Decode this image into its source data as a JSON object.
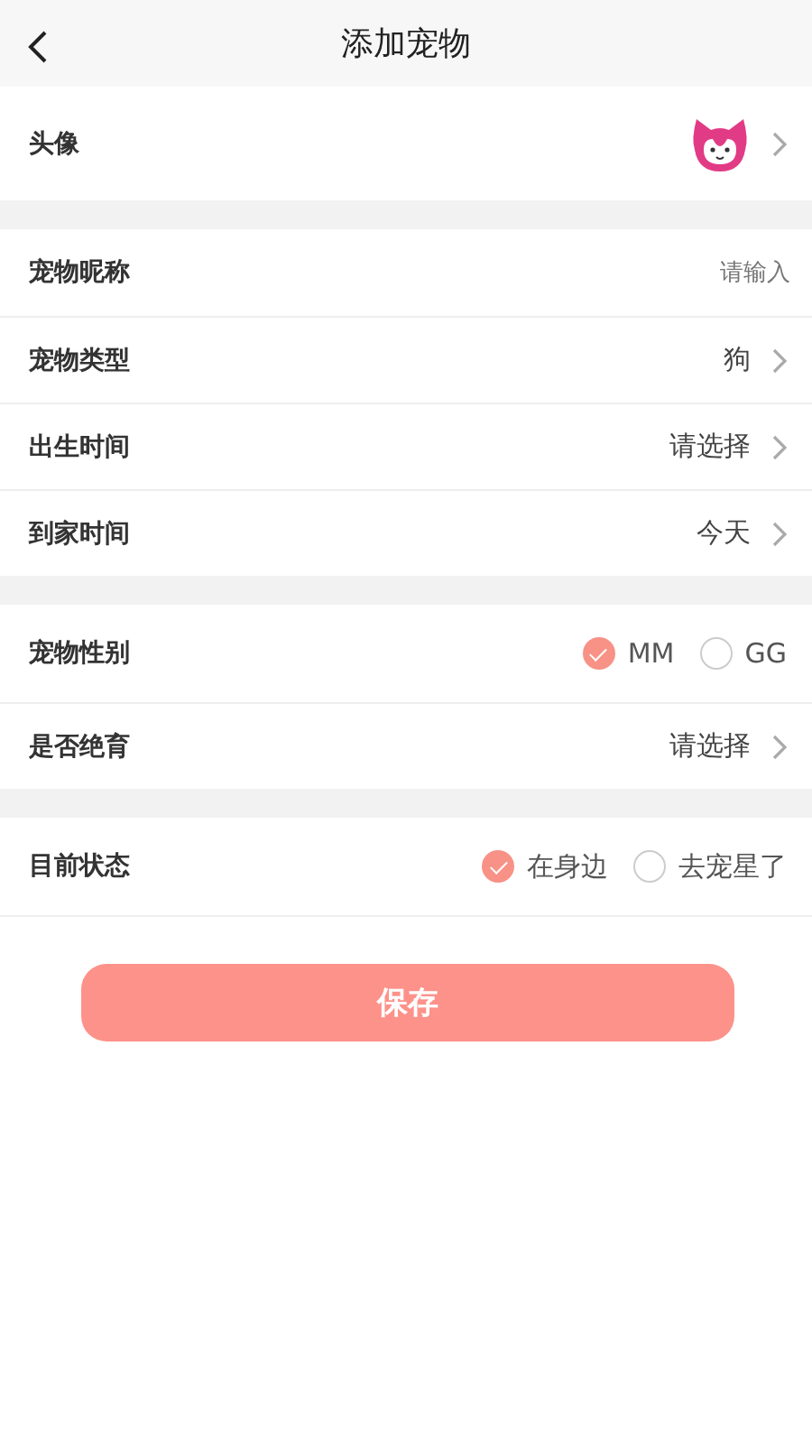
{
  "header": {
    "title": "添加宠物"
  },
  "sections": [
    {
      "rows": [
        {
          "kind": "avatar",
          "label": "头像"
        }
      ]
    },
    {
      "rows": [
        {
          "kind": "input",
          "label": "宠物昵称",
          "placeholder": "请输入"
        },
        {
          "kind": "select",
          "label": "宠物类型",
          "value": "狗"
        },
        {
          "kind": "select",
          "label": "出生时间",
          "value": "请选择"
        },
        {
          "kind": "select",
          "label": "到家时间",
          "value": "今天"
        }
      ]
    },
    {
      "rows": [
        {
          "kind": "radio",
          "label": "宠物性别",
          "options": [
            {
              "label": "MM",
              "selected": true
            },
            {
              "label": "GG",
              "selected": false
            }
          ]
        },
        {
          "kind": "select",
          "label": "是否绝育",
          "value": "请选择"
        }
      ]
    },
    {
      "rows": [
        {
          "kind": "radio",
          "label": "目前状态",
          "options": [
            {
              "label": "在身边",
              "selected": true
            },
            {
              "label": "去宠星了",
              "selected": false
            }
          ]
        }
      ]
    }
  ],
  "save_button": "保存"
}
